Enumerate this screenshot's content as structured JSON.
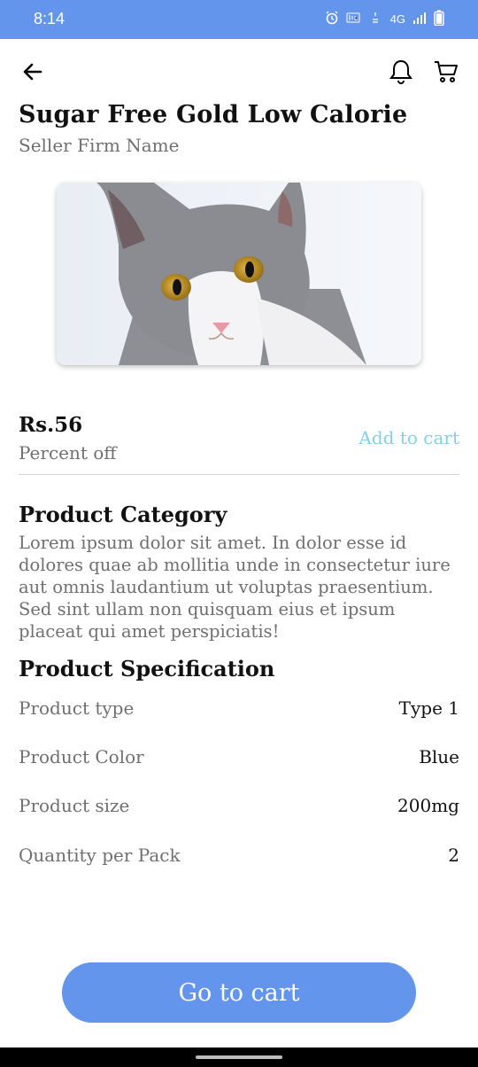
{
  "status_bar": {
    "time": "8:14",
    "network_label": "4G",
    "indicators": [
      "alarm-icon",
      "volte-icon",
      "data-speed-icon",
      "signal-icon",
      "battery-icon"
    ],
    "background_color": "#6495ed"
  },
  "header": {
    "back_icon": "arrow-left-icon",
    "actions": [
      "bell-icon",
      "cart-icon"
    ]
  },
  "product": {
    "title": "Sugar Free Gold Low Calorie",
    "seller": "Seller Firm Name",
    "image": "cat photo",
    "price": "Rs.56",
    "percent": "Percent off",
    "add_to_cart": "Add to cart"
  },
  "category": {
    "heading": "Product Category",
    "description": "Lorem ipsum dolor sit amet. In dolor esse id dolores quae ab mollitia unde in consectetur iure aut omnis laudantium ut voluptas praesentium. Sed sint ullam non quisquam eius et ipsum placeat qui amet perspiciatis!"
  },
  "specification": {
    "heading": "Product Specification",
    "rows": [
      {
        "label": "Product type",
        "value": "Type 1"
      },
      {
        "label": "Product Color",
        "value": "Blue"
      },
      {
        "label": "Product size",
        "value": "200mg"
      },
      {
        "label": "Quantity per Pack",
        "value": "2"
      }
    ]
  },
  "footer": {
    "go_to_cart": "Go to cart",
    "button_color": "#6495ed",
    "accent_link_color": "#87ceeb"
  }
}
